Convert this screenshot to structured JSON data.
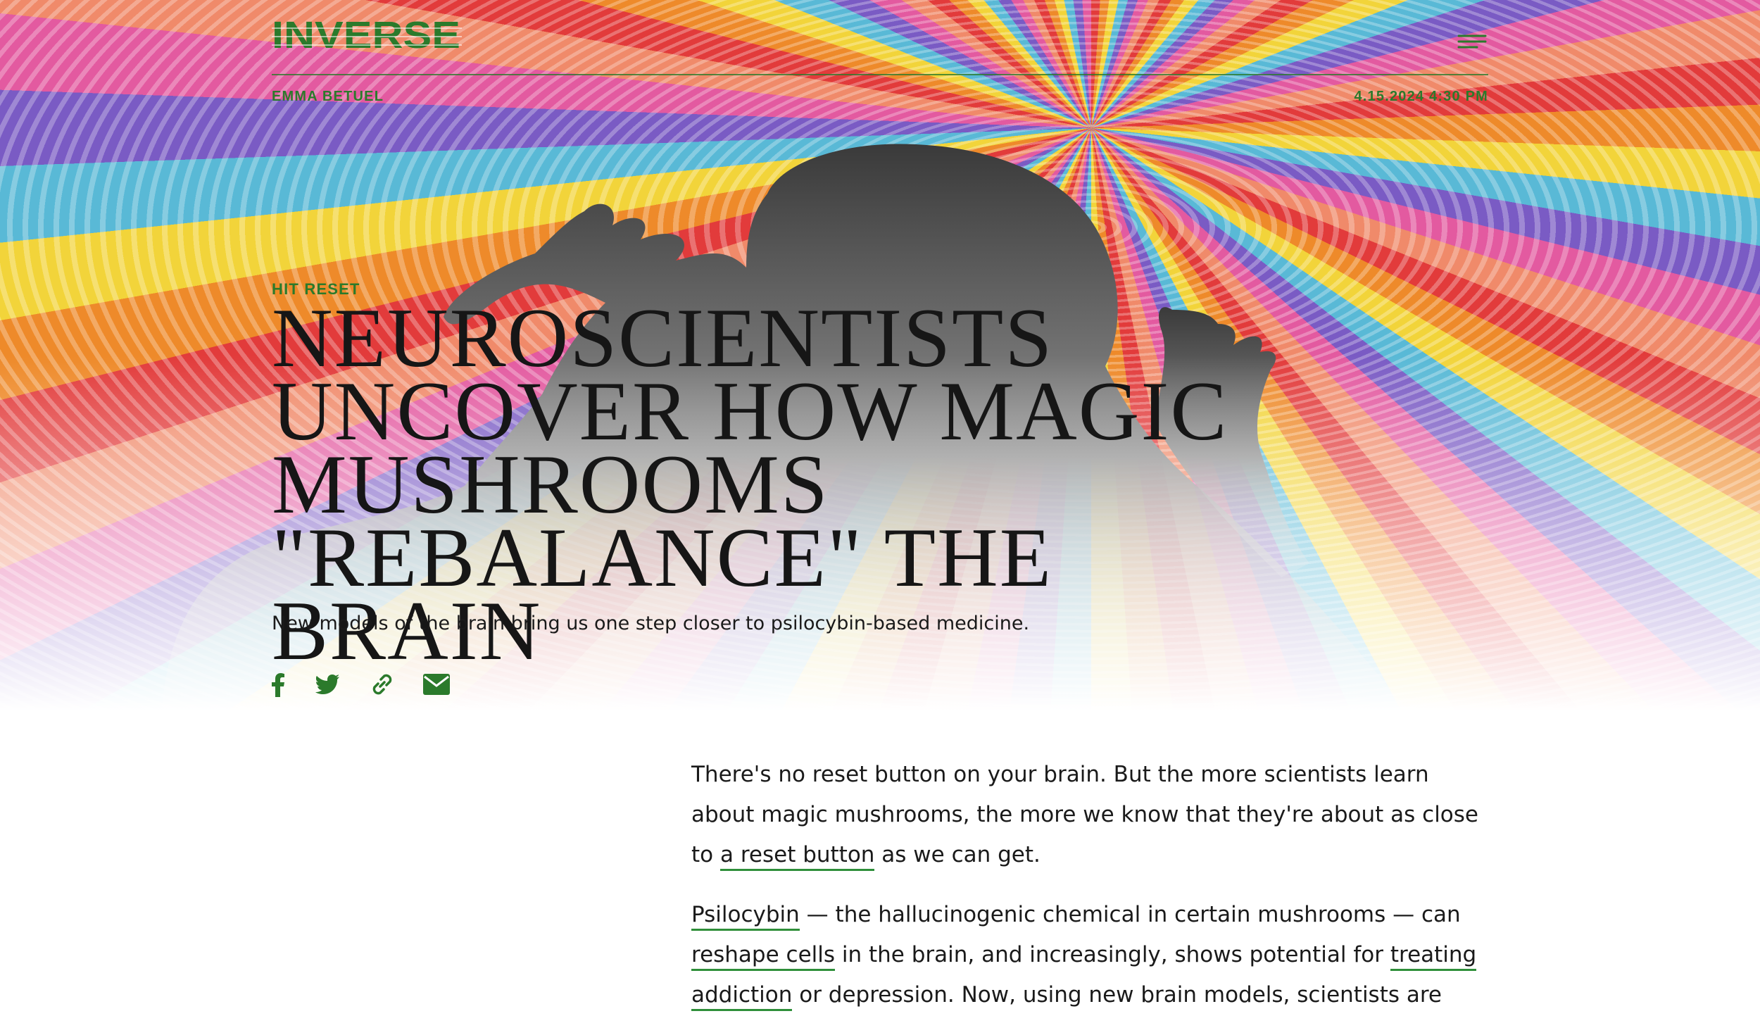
{
  "header": {
    "logo_text": "INVERSE",
    "byline": "EMMA BETUEL",
    "date": "4.15.2024 4:30 PM"
  },
  "article": {
    "kicker": "HIT RESET",
    "headline_lines": [
      "NEUROSCIENTISTS",
      "UNCOVER HOW MAGIC",
      "MUSHROOMS",
      "\"REBALANCE\" THE BRAIN"
    ],
    "dek": "New models of the brain bring us one step closer to psilocybin-based medicine.",
    "paragraphs": [
      {
        "t1": "There's no reset button on your brain. But the more scientists learn about magic mushrooms, the more we know that they're about as close to ",
        "link1": "a reset button",
        "t2": " as we can get."
      },
      {
        "link1": "Psilocybin",
        "t1": " — the hallucinogenic chemical in certain mushrooms — can ",
        "link2": "reshape cells",
        "t2": " in the brain, and increasingly, shows potential for ",
        "link3": "treating addiction",
        "t3": " or depression. Now, using new brain models, scientists are"
      }
    ]
  },
  "share": {
    "icons": [
      "facebook-icon",
      "twitter-icon",
      "link-icon",
      "email-icon"
    ]
  },
  "colors": {
    "accent_green": "#2b7a2b",
    "link_underline": "#2f8f3a",
    "text": "#1a1a1a",
    "headline": "#161616"
  }
}
